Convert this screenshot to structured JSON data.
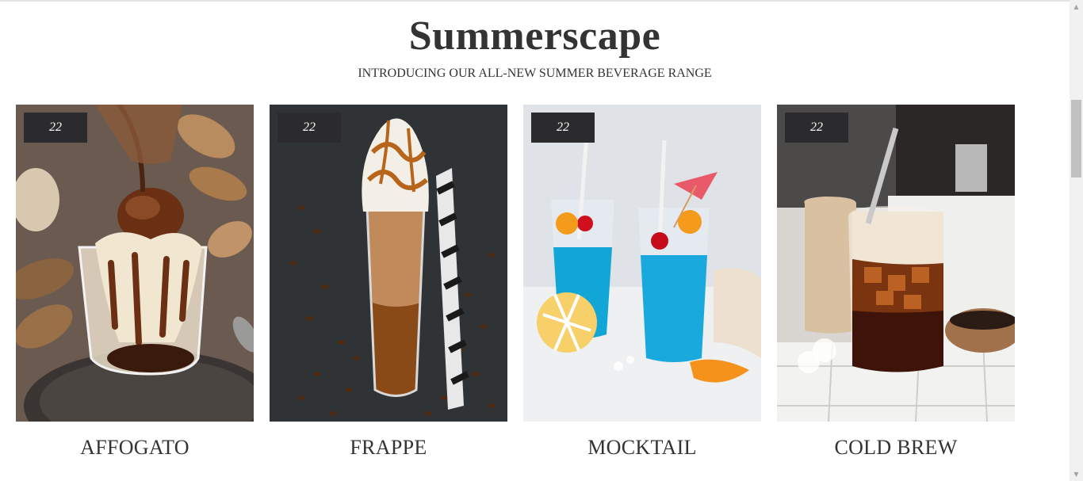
{
  "header": {
    "title": "Summerscape",
    "subtitle": "INTRODUCING OUR ALL-NEW SUMMER BEVERAGE RANGE"
  },
  "products": [
    {
      "name": "AFFOGATO",
      "badge": "22",
      "image_icon": "affogato-photo"
    },
    {
      "name": "FRAPPE",
      "badge": "22",
      "image_icon": "frappe-photo"
    },
    {
      "name": "MOCKTAIL",
      "badge": "22",
      "image_icon": "mocktail-photo"
    },
    {
      "name": "COLD BREW",
      "badge": "22",
      "image_icon": "cold-brew-photo"
    }
  ],
  "colors": {
    "text": "#333333",
    "badge_bg": "#2b2b2d",
    "badge_text": "#ffffff",
    "background": "#ffffff"
  },
  "scrollbar": {
    "up_icon": "scroll-up-arrow-icon",
    "down_icon": "scroll-down-arrow-icon"
  }
}
